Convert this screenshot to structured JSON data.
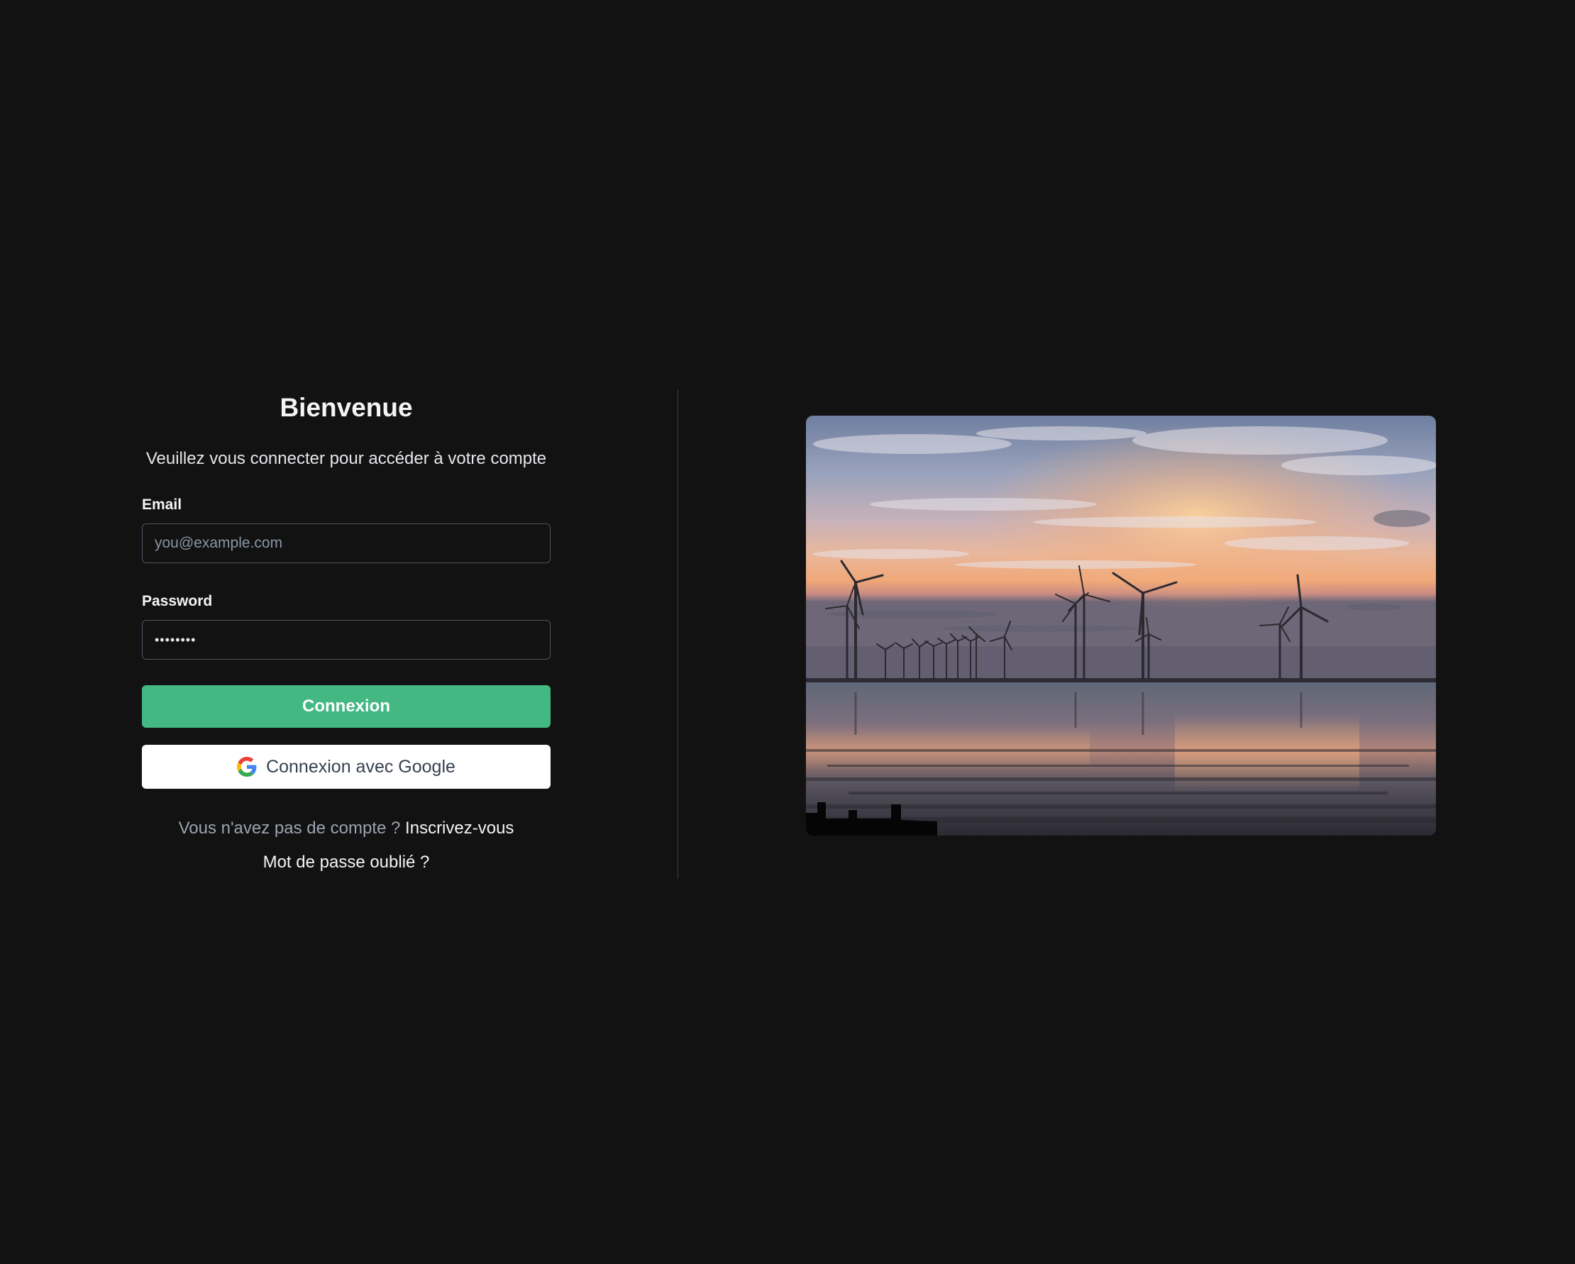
{
  "login": {
    "title": "Bienvenue",
    "subtitle": "Veuillez vous connecter pour accéder à votre compte",
    "email": {
      "label": "Email",
      "placeholder": "you@example.com",
      "value": ""
    },
    "password": {
      "label": "Password",
      "value": "••••••••"
    },
    "submit_label": "Connexion",
    "google": {
      "label": "Connexion avec Google",
      "icon": "google-icon"
    },
    "signup_prompt": "Vous n'avez pas de compte ?",
    "signup_link": "Inscrivez-vous",
    "forgot_link": "Mot de passe oublié ?"
  },
  "hero": {
    "image": "wind-turbines-sunset-photo"
  },
  "colors": {
    "background": "#121212",
    "primary": "#43b883",
    "divider": "#3f3f46",
    "input_border": "#4b5563"
  }
}
